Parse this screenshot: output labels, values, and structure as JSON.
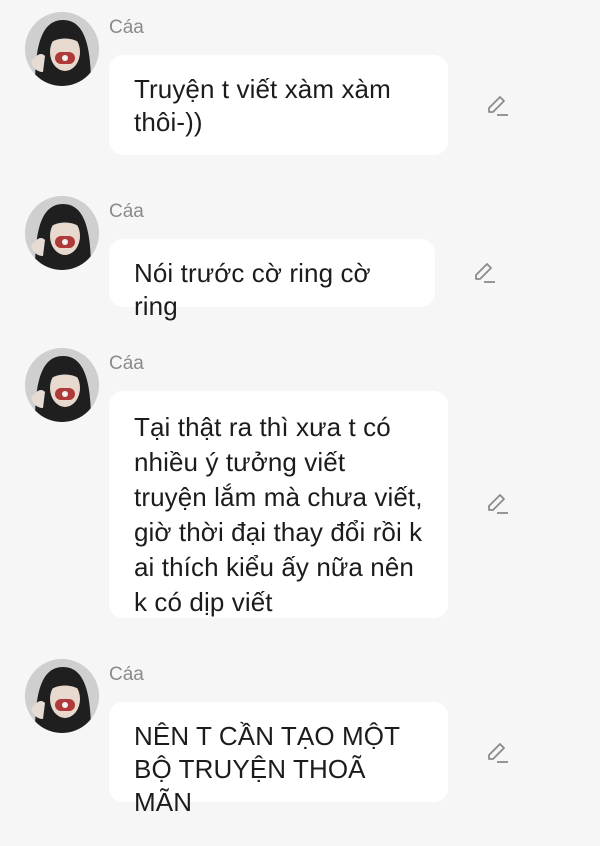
{
  "sender_name": "Cáa",
  "messages": [
    {
      "text": "Truyện t viết xàm xàm thôi-))"
    },
    {
      "text": "Nói trước cờ ring cờ ring"
    },
    {
      "text": "Tại thật ra thì xưa t có nhiều ý tưởng viết truyện lắm mà chưa viết, giờ thời đại thay đổi rồi k ai thích kiểu ấy nữa nên k có dịp viết"
    },
    {
      "text": "NÊN T CẦN TẠO MỘT BỘ TRUYỆN THOÃ MÃN"
    }
  ],
  "icons": {
    "avatar": "avatar-photo",
    "edit": "pencil-icon"
  },
  "colors": {
    "background": "#f6f6f6",
    "bubble": "#ffffff",
    "sender": "#8a8a8a",
    "text": "#1c1c1c",
    "icon": "#8c8c8c"
  }
}
